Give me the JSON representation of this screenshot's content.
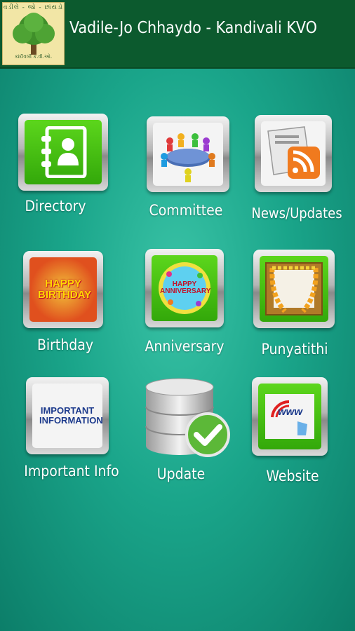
{
  "app": {
    "title": "Vadile-Jo Chhaydo - Kandivali KVO",
    "logo_arc_text": "વડીલે - જો - છાંયડો",
    "logo_bottom_text": "કાંદીવલી   ક.વી.ઓ."
  },
  "menu": [
    {
      "label": "Directory",
      "icon": "address-book-icon"
    },
    {
      "label": "Committee",
      "icon": "meeting-icon"
    },
    {
      "label": "News/Updates",
      "icon": "newspaper-rss-icon"
    },
    {
      "label": "Birthday",
      "icon": "birthday-icon",
      "icon_text": "HAPPY BIRTHDAY"
    },
    {
      "label": "Anniversary",
      "icon": "anniversary-balloon-icon",
      "icon_text": "HAPPY ANNIVERSARY"
    },
    {
      "label": "Punyatithi",
      "icon": "garland-frame-icon"
    },
    {
      "label": "Important Info",
      "icon": "important-information-icon",
      "icon_text": "IMPORTANT INFORMATION"
    },
    {
      "label": "Update",
      "icon": "database-check-icon"
    },
    {
      "label": "Website",
      "icon": "www-hand-icon",
      "icon_text": "www"
    }
  ],
  "colors": {
    "header": "#0c5a2e",
    "tile_green": "#3fbf12",
    "background": "#1aa58a"
  }
}
